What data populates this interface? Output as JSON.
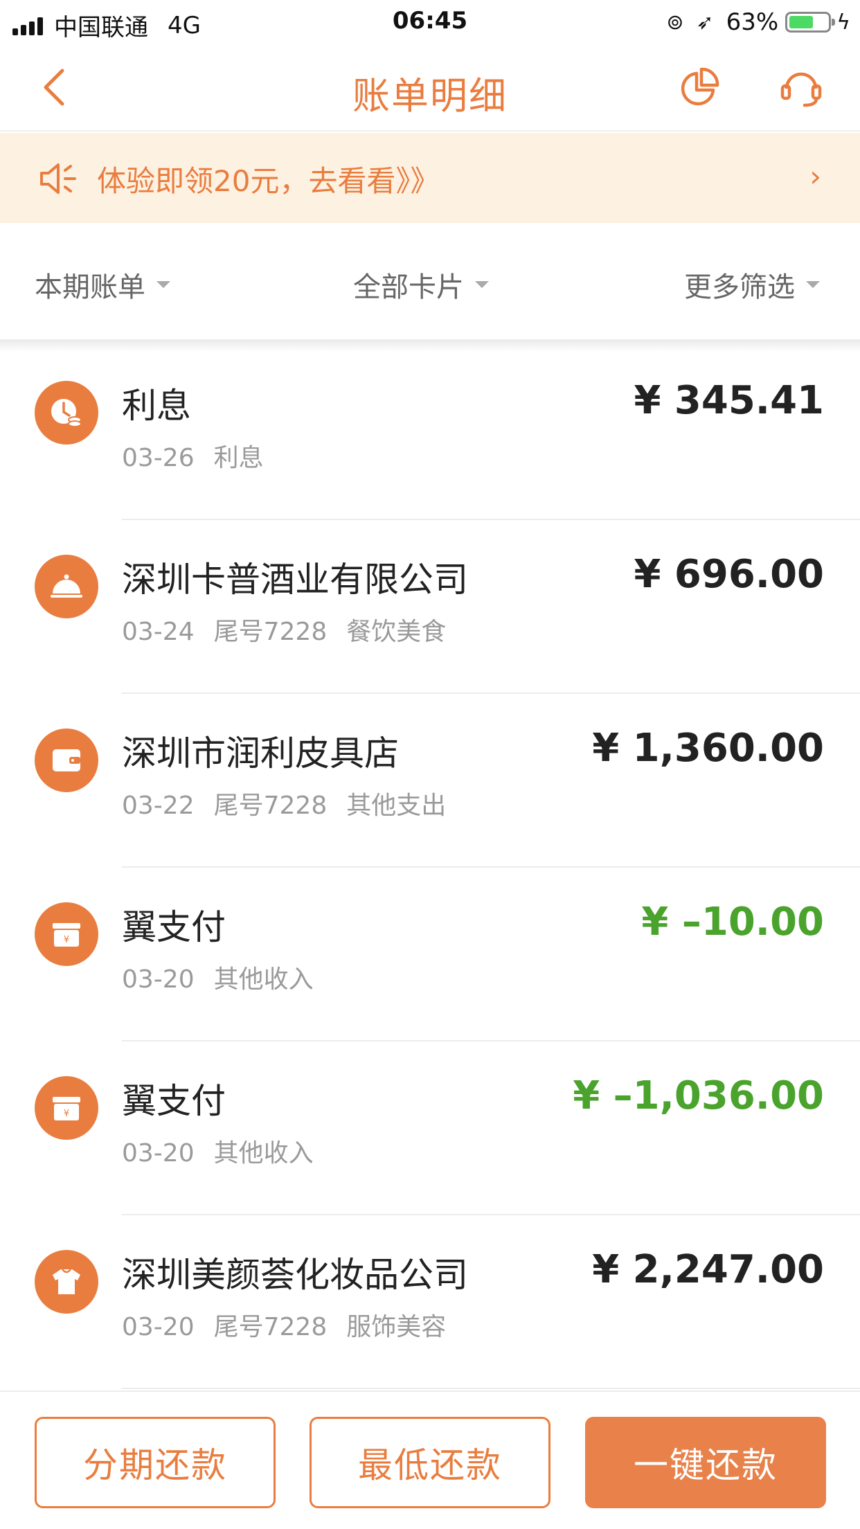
{
  "status_bar": {
    "carrier": "中国联通",
    "network": "4G",
    "time": "06:45",
    "battery_percent": "63%",
    "battery_level": 0.63
  },
  "nav": {
    "title": "账单明细",
    "icons": [
      "back-icon",
      "pie-chart-icon",
      "customer-service-icon"
    ]
  },
  "banner": {
    "text": "体验即领20元，去看看》》",
    "arrow": "›"
  },
  "filters": [
    {
      "label": "本期账单"
    },
    {
      "label": "全部卡片"
    },
    {
      "label": "更多筛选"
    }
  ],
  "transactions": [
    {
      "title": "利息",
      "date": "03-26",
      "card": "",
      "category": "利息",
      "amount": "¥ 345.41",
      "icon": "interest-icon",
      "income": false
    },
    {
      "title": "深圳卡普酒业有限公司",
      "date": "03-24",
      "card": "尾号7228",
      "category": "餐饮美食",
      "amount": "¥ 696.00",
      "icon": "dining-cloche-icon",
      "income": false
    },
    {
      "title": "深圳市润利皮具店",
      "date": "03-22",
      "card": "尾号7228",
      "category": "其他支出",
      "amount": "¥ 1,360.00",
      "icon": "wallet-icon",
      "income": false
    },
    {
      "title": "翼支付",
      "date": "03-20",
      "card": "",
      "category": "其他收入",
      "amount": "¥ –10.00",
      "icon": "income-box-icon",
      "income": true
    },
    {
      "title": "翼支付",
      "date": "03-20",
      "card": "",
      "category": "其他收入",
      "amount": "¥ –1,036.00",
      "icon": "income-box-icon",
      "income": true
    },
    {
      "title": "深圳美颜荟化妆品公司",
      "date": "03-20",
      "card": "尾号7228",
      "category": "服饰美容",
      "amount": "¥ 2,247.00",
      "icon": "clothing-icon",
      "income": false
    }
  ],
  "actions": {
    "installment": "分期还款",
    "minimum": "最低还款",
    "one_click": "一键还款"
  },
  "colors": {
    "accent": "#e97d3f",
    "income_green": "#4aa32c",
    "banner_bg": "#fdf1e1"
  }
}
